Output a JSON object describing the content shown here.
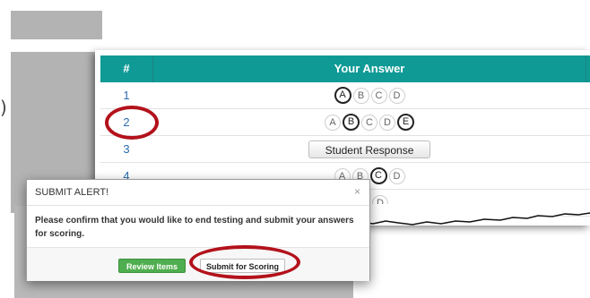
{
  "table": {
    "header_num": "#",
    "header_answer": "Your Answer",
    "rows": [
      {
        "num": "1",
        "choices": [
          "A",
          "B",
          "C",
          "D"
        ],
        "selected": [
          "A"
        ]
      },
      {
        "num": "2",
        "choices": [
          "A",
          "B",
          "C",
          "D",
          "E"
        ],
        "selected": [
          "B",
          "E"
        ]
      },
      {
        "num": "3",
        "button": "Student Response"
      },
      {
        "num": "4",
        "choices": [
          "A",
          "B",
          "C",
          "D"
        ],
        "selected": [
          "C"
        ]
      },
      {
        "choices": [
          "C",
          "D"
        ],
        "selected": []
      }
    ]
  },
  "dialog": {
    "title": "SUBMIT ALERT!",
    "close": "×",
    "message": "Please confirm that you would like to end testing and submit your answers for scoring.",
    "review_label": "Review Items",
    "submit_label": "Submit for Scoring"
  },
  "decor": {
    "paren": ")"
  },
  "colors": {
    "header": "#0f9a96",
    "highlight_circle": "#b3121b",
    "review_button": "#4fae4f",
    "row_number": "#2a6cb0"
  }
}
